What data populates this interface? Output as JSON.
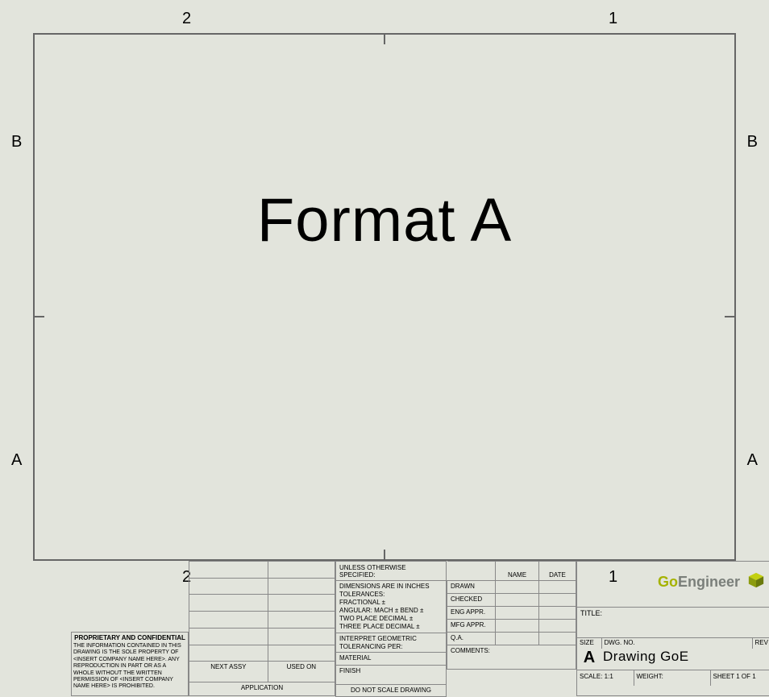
{
  "zones": {
    "top2": "2",
    "top1": "1",
    "bot2": "2",
    "bot1": "1",
    "leftB": "B",
    "leftA": "A",
    "rightB": "B",
    "rightA": "A"
  },
  "center": "Format A",
  "proprietary": {
    "title": "PROPRIETARY AND CONFIDENTIAL",
    "body": "THE INFORMATION CONTAINED IN THIS DRAWING IS THE SOLE PROPERTY OF <INSERT COMPANY NAME HERE>.  ANY REPRODUCTION IN PART OR AS A WHOLE WITHOUT THE WRITTEN PERMISSION OF <INSERT COMPANY NAME HERE> IS PROHIBITED."
  },
  "rev": {
    "nextAssy": "NEXT ASSY",
    "usedOn": "USED ON",
    "application": "APPLICATION"
  },
  "tol": {
    "unless": "UNLESS OTHERWISE SPECIFIED:",
    "dims": "DIMENSIONS ARE IN INCHES",
    "tolerances": "TOLERANCES:",
    "fractional": "FRACTIONAL ±",
    "angular": "ANGULAR: MACH ±    BEND  ±",
    "twoPlace": "TWO PLACE DECIMAL    ±",
    "threePlace": "THREE PLACE DECIMAL  ±",
    "interpret": "INTERPRET GEOMETRIC",
    "tolPer": "TOLERANCING PER:",
    "material": "MATERIAL",
    "finish": "FINISH",
    "doNotScale": "DO NOT SCALE DRAWING"
  },
  "sign": {
    "name": "NAME",
    "date": "DATE",
    "drawn": "DRAWN",
    "checked": "CHECKED",
    "engAppr": "ENG APPR.",
    "mfgAppr": "MFG APPR.",
    "qa": "Q.A.",
    "comments": "COMMENTS:"
  },
  "logo": {
    "go": "Go",
    "engineer": "Engineer"
  },
  "title": {
    "label": "TITLE:"
  },
  "dwg": {
    "sizeLabel": "SIZE",
    "sizeVal": "A",
    "dwgNoLabel": "DWG.  NO.",
    "revLabel": "REV",
    "dwgName": "Drawing GoE"
  },
  "bottom": {
    "scale": "SCALE: 1:1",
    "weight": "WEIGHT:",
    "sheet": "SHEET 1 OF 1"
  }
}
